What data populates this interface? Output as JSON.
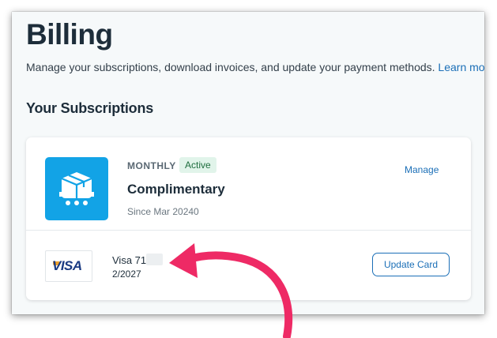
{
  "page": {
    "title": "Billing",
    "description": "Manage your subscriptions, download invoices, and update your payment methods.",
    "learn_more": "Learn mo"
  },
  "subscriptions": {
    "heading": "Your Subscriptions",
    "items": [
      {
        "frequency": "MONTHLY",
        "status": "Active",
        "plan": "Complimentary",
        "since": "Since Mar 20240",
        "manage_label": "Manage",
        "icon": "delivery-cart-icon"
      }
    ]
  },
  "payment": {
    "brand": "VISA",
    "card_label": "Visa 71",
    "expiry": "2/2027",
    "update_label": "Update Card"
  },
  "annotation": {
    "type": "red-curved-arrow",
    "color": "#ee2a65",
    "points_to": "card-number"
  },
  "colors": {
    "accent": "#1b6fb7",
    "plan_icon_bg": "#12a3e6",
    "badge_bg": "#e1f4ea",
    "badge_text": "#1e6d3e"
  }
}
